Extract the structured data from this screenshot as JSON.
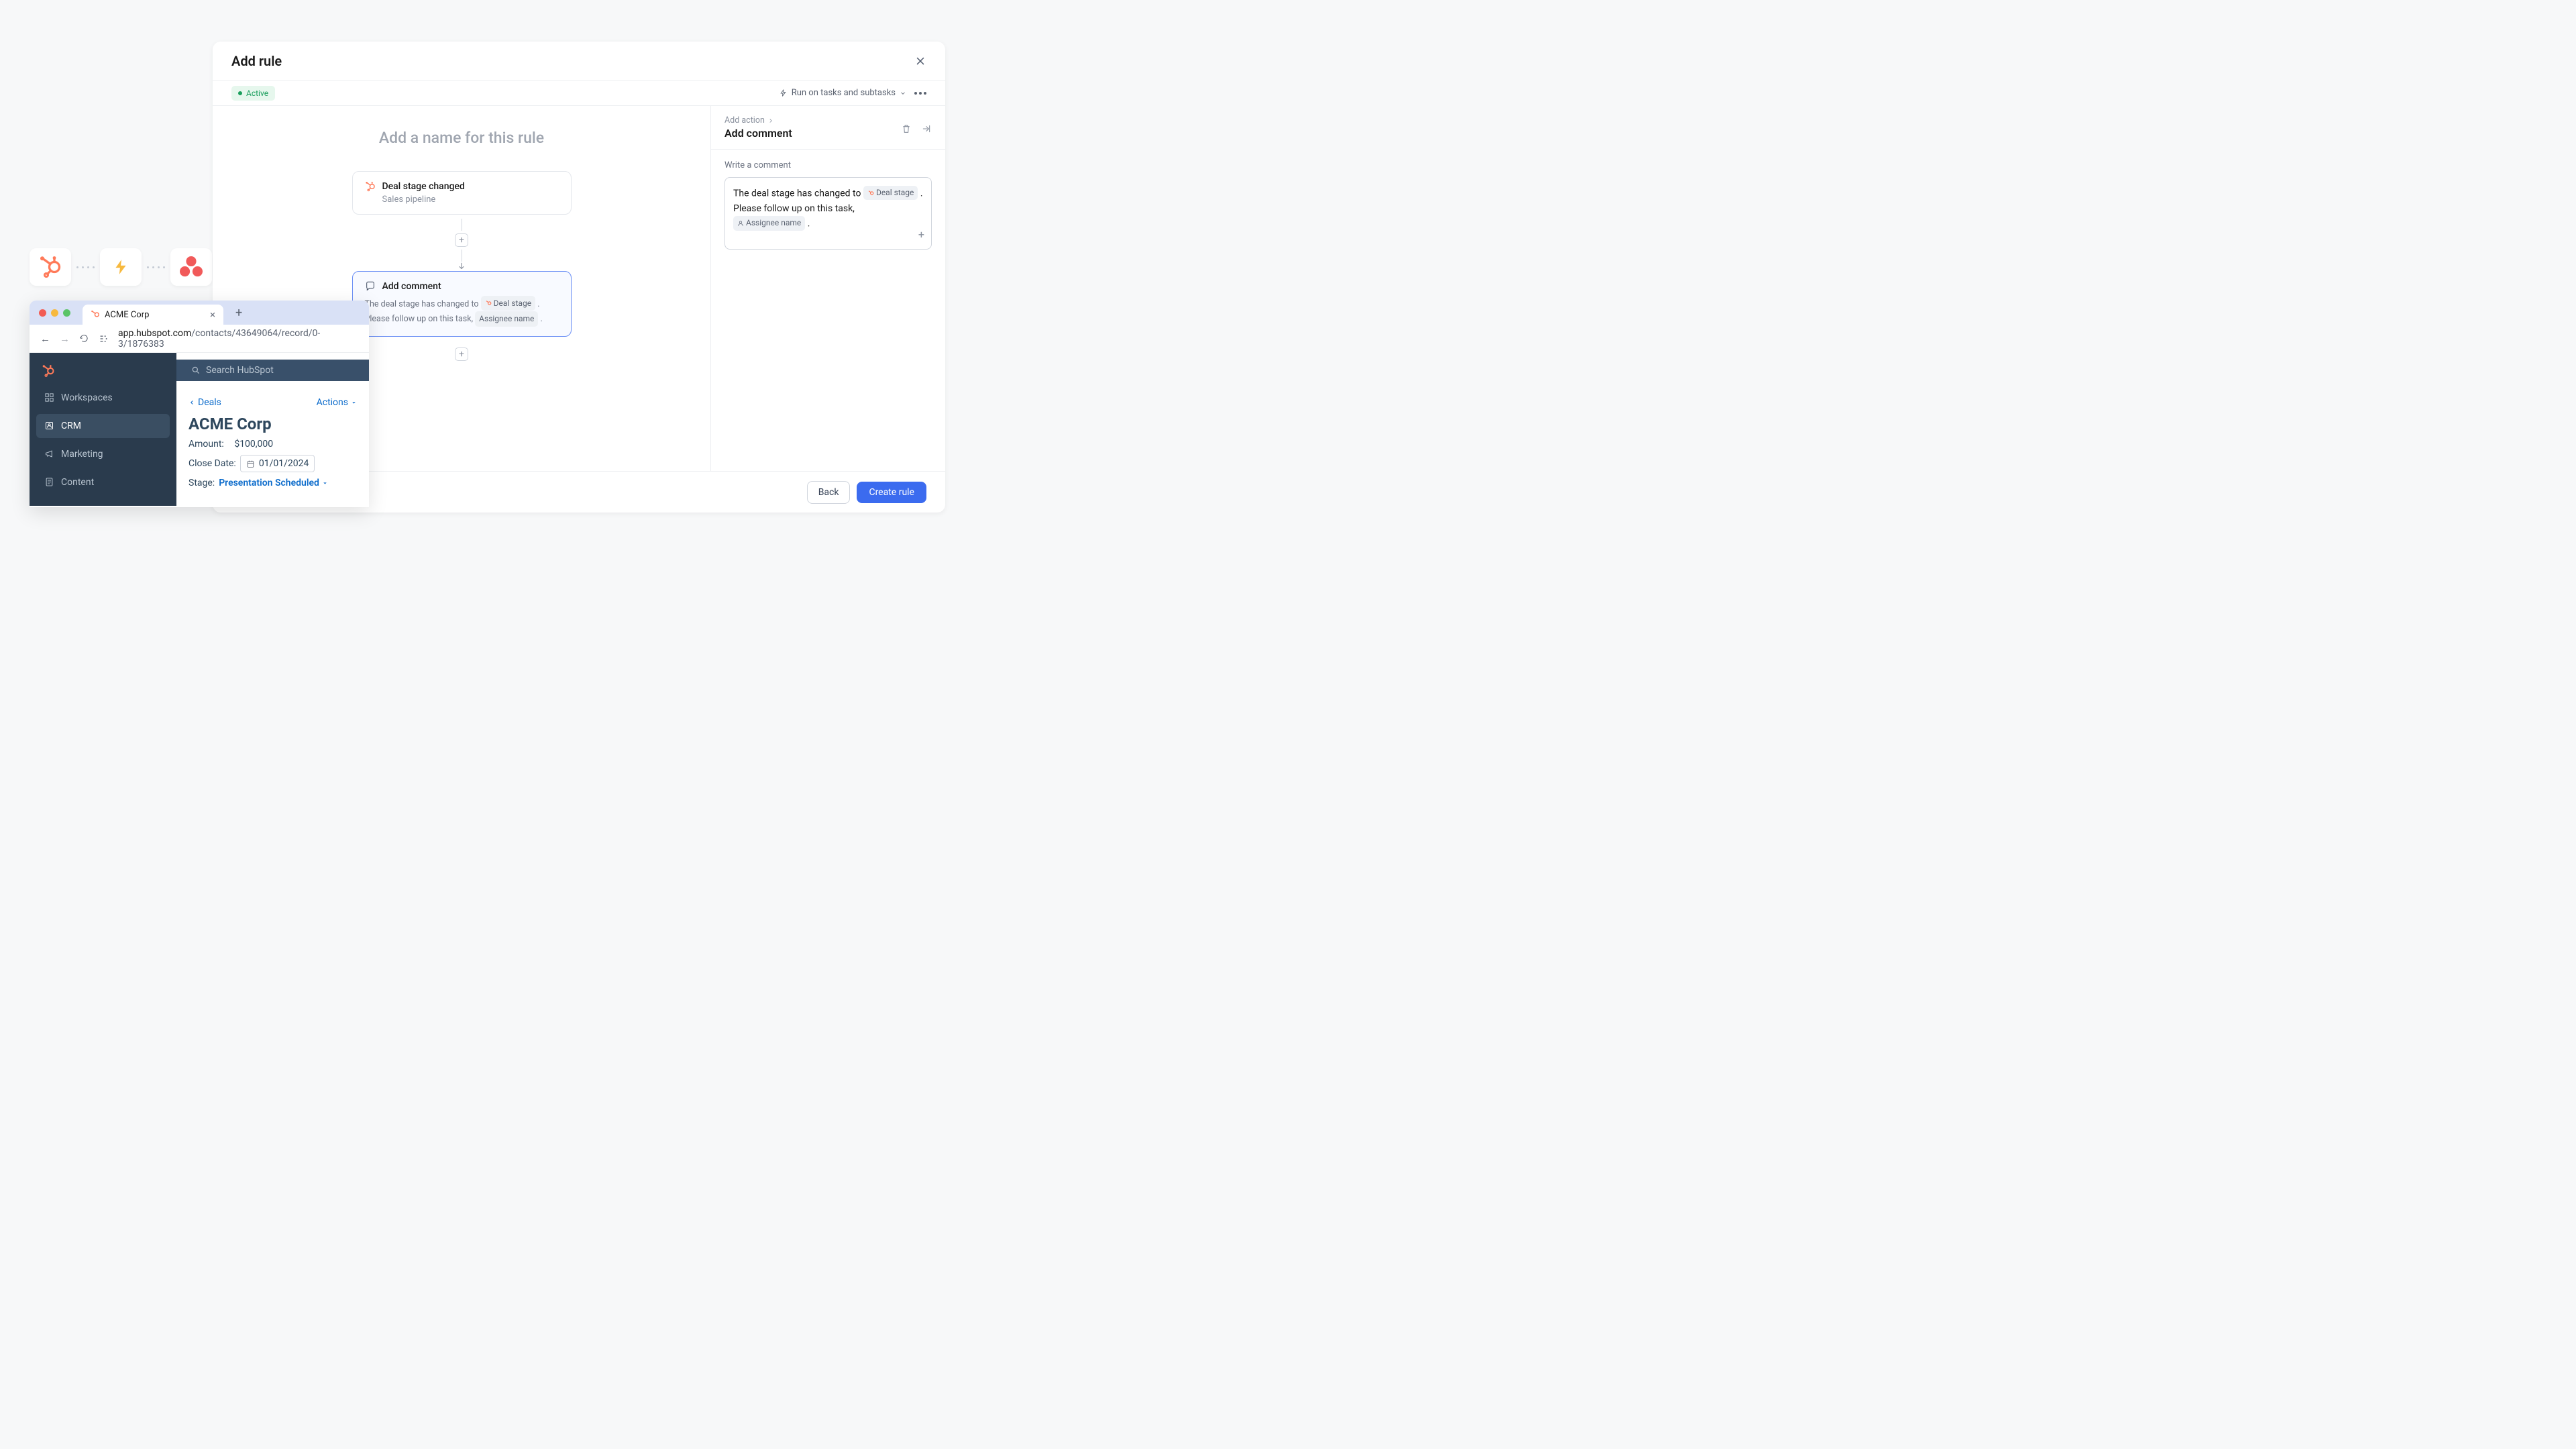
{
  "dialog": {
    "title": "Add rule",
    "status": "Active",
    "run_scope": "Run on tasks and subtasks",
    "rule_name_placeholder": "Add a name for this rule",
    "trigger": {
      "title": "Deal stage changed",
      "subtitle": "Sales pipeline"
    },
    "action": {
      "title": "Add comment",
      "body_pre": "The deal stage has changed to",
      "token1": "Deal stage",
      "body_mid": ".",
      "body_line2_pre": "Please follow up on this task,",
      "token2": "Assignee name",
      "body_end": "."
    }
  },
  "side": {
    "crumb": "Add action",
    "title": "Add comment",
    "label": "Write a comment",
    "comment_pre": "The deal stage has changed to",
    "token1": "Deal stage",
    "comment_mid": ".",
    "comment_line2_pre": "Please follow up on this task,",
    "token2": "Assignee name",
    "comment_end": "."
  },
  "footer": {
    "back": "Back",
    "create": "Create rule"
  },
  "browser": {
    "tab_title": "ACME Corp",
    "url_domain": "app.hubspot.com",
    "url_path": "/contacts/43649064/record/0-3/1876383",
    "search_placeholder": "Search HubSpot",
    "nav": {
      "workspaces": "Workspaces",
      "crm": "CRM",
      "marketing": "Marketing",
      "content": "Content"
    },
    "deals_back": "Deals",
    "actions": "Actions",
    "company": "ACME Corp",
    "amount_label": "Amount:",
    "amount_value": "$100,000",
    "close_date_label": "Close Date:",
    "close_date_value": "01/01/2024",
    "stage_label": "Stage:",
    "stage_value": "Presentation Scheduled"
  }
}
